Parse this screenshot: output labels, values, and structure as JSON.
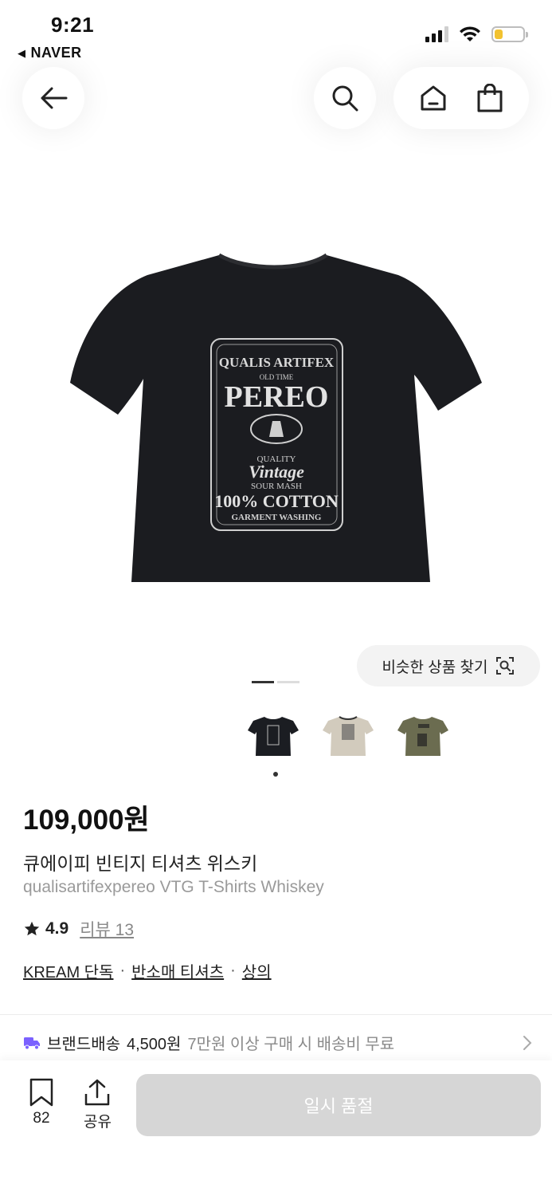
{
  "status_bar": {
    "time": "9:21",
    "back_app": "NAVER",
    "battery_level": 0.3
  },
  "nav": {
    "back_icon": "arrow-left-icon",
    "search_icon": "search-icon",
    "home_icon": "home-icon",
    "cart_icon": "shopping-bag-icon"
  },
  "product_image": {
    "label_line1": "QUALIS ARTIFEX",
    "label_line2": "OLD TIME",
    "label_line3": "PEREO",
    "label_line4": "QUALITY",
    "label_line5": "Vintage",
    "label_line6": "SOUR MASH",
    "label_line7": "100% COTTON",
    "label_line8": "GARMENT WASHING"
  },
  "similar_button": {
    "label": "비슷한 상품 찾기",
    "icon": "visual-search-icon"
  },
  "gallery": {
    "current_page": 1,
    "total_pages": 2
  },
  "thumbnails": [
    {
      "color": "#1b1d22",
      "name": "black-tee"
    },
    {
      "color": "#d2cbbd",
      "name": "cream-tee"
    },
    {
      "color": "#6b6c50",
      "name": "olive-tee"
    }
  ],
  "product": {
    "price": "109,000원",
    "name_ko": "큐에이피 빈티지 티셔츠 위스키",
    "name_en": "qualisartifexpereo VTG T-Shirts Whiskey",
    "rating": "4.9",
    "reviews": "리뷰 13"
  },
  "categories": [
    {
      "label": "KREAM 단독"
    },
    {
      "label": "반소매 티셔츠"
    },
    {
      "label": "상의"
    }
  ],
  "shipping": {
    "label": "브랜드배송",
    "fee": "4,500원",
    "note": "7만원 이상 구매 시 배송비 무료"
  },
  "bottom_bar": {
    "bookmark_count": "82",
    "share_label": "공유",
    "action_label": "일시 품절"
  },
  "colors": {
    "accent_purple": "#7b61ff",
    "disabled_button": "#d6d6d6"
  }
}
